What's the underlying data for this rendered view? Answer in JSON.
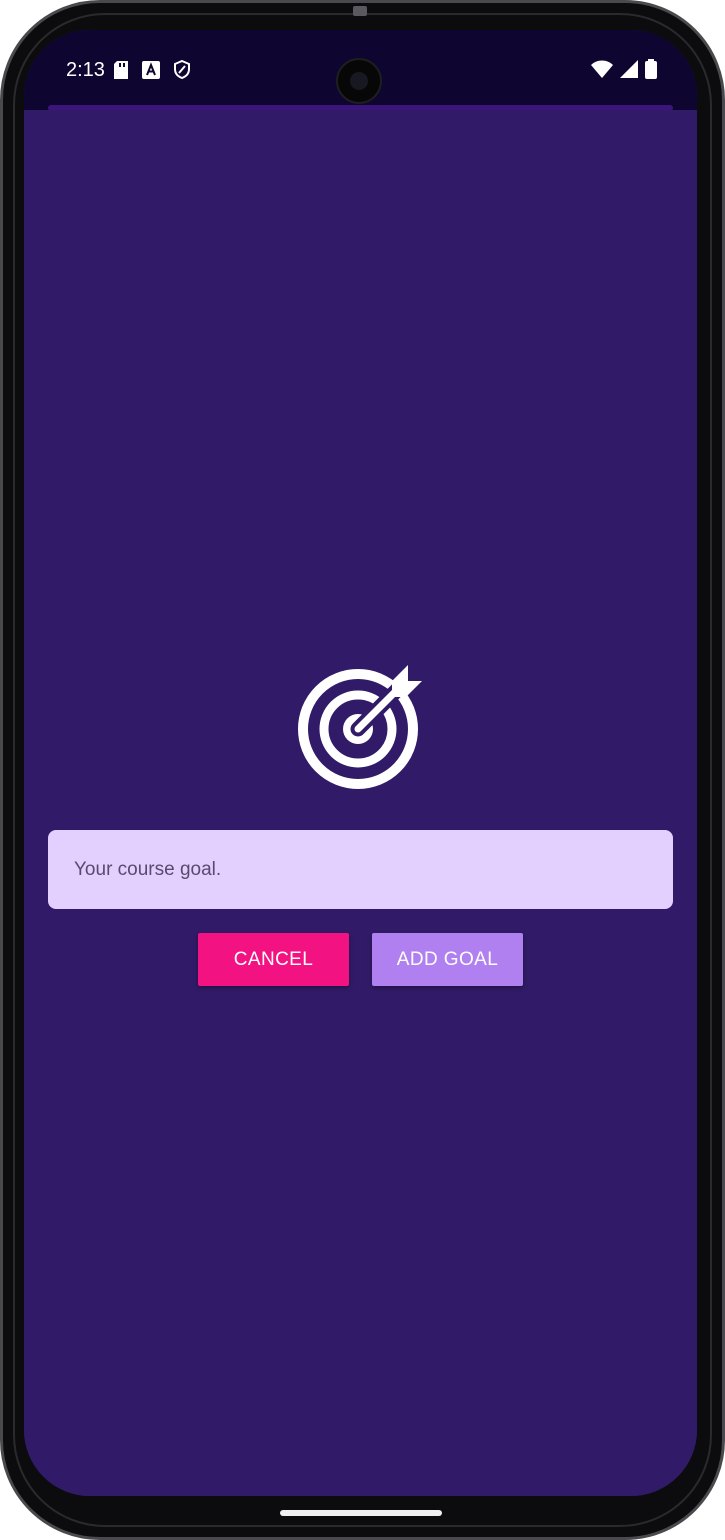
{
  "status_bar": {
    "time": "2:13",
    "left_icons": [
      "sd-card-icon",
      "text-a-icon",
      "shield-icon"
    ],
    "right_icons": [
      "wifi-icon",
      "cellular-signal-icon",
      "battery-icon"
    ]
  },
  "goal_form": {
    "icon": "target-icon",
    "input_placeholder": "Your course goal.",
    "input_value": "",
    "cancel_label": "CANCEL",
    "add_label": "ADD GOAL"
  },
  "colors": {
    "background": "#311b68",
    "status_bar": "#0e0530",
    "input_bg": "#e4d0ff",
    "cancel_button": "#f31282",
    "add_button": "#b180f0"
  }
}
